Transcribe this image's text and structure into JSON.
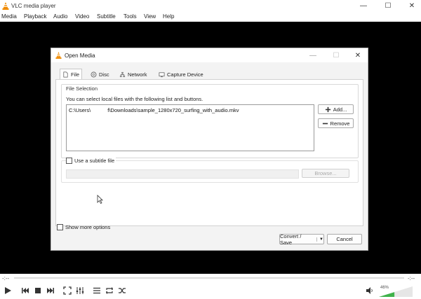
{
  "window": {
    "title": "VLC media player",
    "controls": [
      "minimize",
      "maximize",
      "close"
    ]
  },
  "menubar": {
    "items": [
      "Media",
      "Playback",
      "Audio",
      "Video",
      "Subtitle",
      "Tools",
      "View",
      "Help"
    ]
  },
  "player": {
    "elapsed": "-:--",
    "remaining": "-:--",
    "volume": "46%",
    "volume_level": 0.46,
    "icons": [
      "play-icon",
      "previous-icon",
      "stop-icon",
      "next-icon",
      "fullscreen-icon",
      "extended-settings-icon",
      "playlist-icon",
      "loop-icon",
      "shuffle-icon",
      "volume-icon"
    ]
  },
  "dialog": {
    "title": "Open Media",
    "tabs": [
      {
        "label": "File",
        "icon": "file-icon",
        "active": true
      },
      {
        "label": "Disc",
        "icon": "disc-icon",
        "active": false
      },
      {
        "label": "Network",
        "icon": "network-icon",
        "active": false
      },
      {
        "label": "Capture Device",
        "icon": "capture-device-icon",
        "active": false
      }
    ],
    "file_selection": {
      "legend": "File Selection",
      "description": "You can select local files with the following list and buttons.",
      "file_prefix": "C:\\Users\\",
      "file_suffix": "f\\Downloads\\sample_1280x720_surfing_with_audio.mkv",
      "add_label": "Add...",
      "remove_label": "Remove"
    },
    "subtitle": {
      "checkbox_label": "Use a subtitle file",
      "checked": false,
      "browse_label": "Browse..."
    },
    "show_more_label": "Show more options",
    "show_more_checked": false,
    "convert_label": "Convert / Save",
    "cancel_label": "Cancel"
  }
}
